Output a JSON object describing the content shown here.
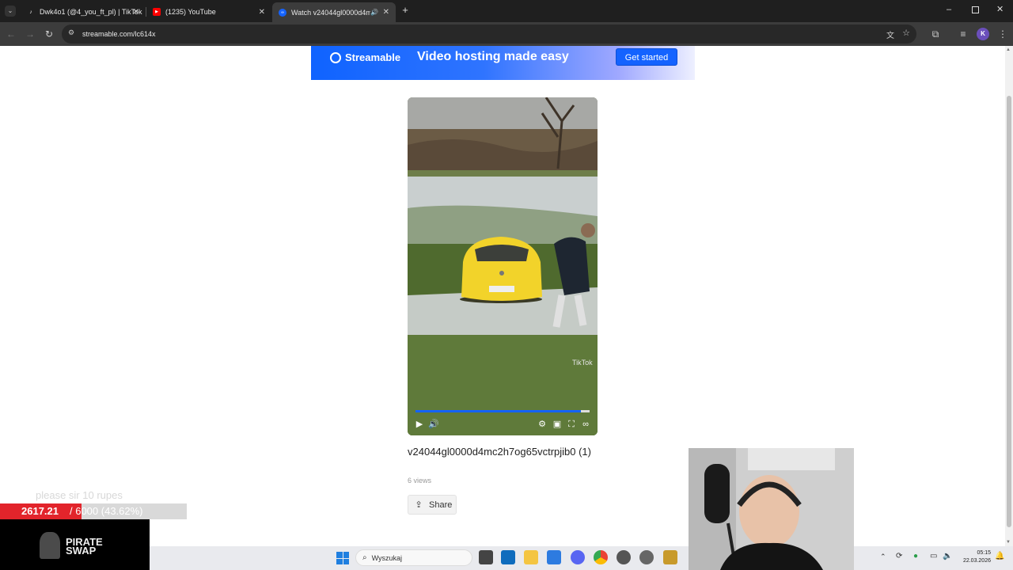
{
  "tabs": [
    {
      "title": "Dwk4o1 (@4_you_ft_pl) | TikTok",
      "favicon": "tiktok-icon"
    },
    {
      "title": "(1235) YouTube",
      "favicon": "youtube-icon"
    },
    {
      "title": "Watch v24044gl0000d4mc…",
      "favicon": "streamable-icon",
      "active": true
    }
  ],
  "toolbar": {
    "url": "streamable.com/lc614x",
    "profile_initial": "K"
  },
  "banner": {
    "brand": "Streamable",
    "tagline": "Video hosting made easy",
    "cta": "Get started"
  },
  "video": {
    "title": "v24044gl0000d4mc2h7og65vctrpjib0 (1)",
    "views": "6 views",
    "share_label": "Share",
    "progress": 0.95,
    "watermark": "TikTok"
  },
  "overlay": {
    "donation_message": "please sir 10 rupes",
    "donation_current": "2617.21",
    "donation_rest": "/ 6000 (43.62%)",
    "donation_fraction": 0.4362,
    "sponsor_line1": "PIRATE",
    "sponsor_line2": "SWAP"
  },
  "taskbar": {
    "search_placeholder": "Wyszukaj",
    "time": "05:15",
    "date": "22.03.2026"
  },
  "colors": {
    "accent": "#1463ff",
    "donation_red": "#e2242b"
  }
}
